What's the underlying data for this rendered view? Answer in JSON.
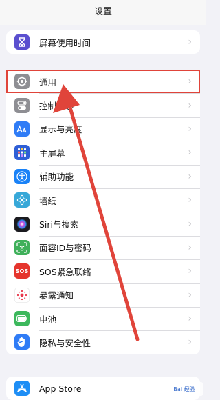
{
  "header": {
    "title": "设置"
  },
  "group0": [
    {
      "label": "屏幕使用时间",
      "icon": "hourglass-icon",
      "color": "#5a4fcf"
    }
  ],
  "group1": [
    {
      "label": "通用",
      "icon": "gear-icon",
      "color": "#8e8e93"
    },
    {
      "label": "控制中心",
      "icon": "control-center-icon",
      "color": "#8e8e93"
    },
    {
      "label": "显示与亮度",
      "icon": "aa-icon",
      "color": "#2f7cf6"
    },
    {
      "label": "主屏幕",
      "icon": "home-grid-icon",
      "color": "#2f5fd6"
    },
    {
      "label": "辅助功能",
      "icon": "accessibility-icon",
      "color": "#1a82f7"
    },
    {
      "label": "墙纸",
      "icon": "wallpaper-flower-icon",
      "color": "#37a8d8"
    },
    {
      "label": "Siri与搜索",
      "icon": "siri-icon",
      "color": "#1b1b1f"
    },
    {
      "label": "面容ID与密码",
      "icon": "face-id-icon",
      "color": "#3fb05a"
    },
    {
      "label": "SOS紧急联络",
      "icon": "sos-icon",
      "color": "#e5352d",
      "badge": "SOS"
    },
    {
      "label": "暴露通知",
      "icon": "exposure-icon",
      "color": "#ffffff"
    },
    {
      "label": "电池",
      "icon": "battery-icon",
      "color": "#3cb85c"
    },
    {
      "label": "隐私与安全性",
      "icon": "hand-icon",
      "color": "#2f7cf6"
    }
  ],
  "group2": [
    {
      "label": "App Store",
      "icon": "app-store-icon",
      "color": "#1e8ef5"
    }
  ],
  "annotation": {
    "highlight_color": "#e0443a"
  },
  "watermark": {
    "text": "Bai 经验"
  }
}
